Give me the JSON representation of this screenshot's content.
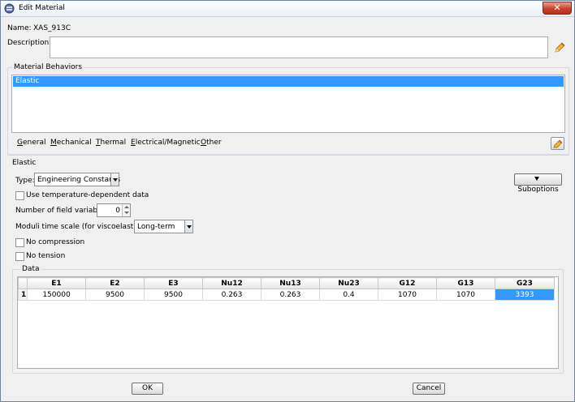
{
  "window": {
    "title": "Edit Material"
  },
  "name_field": {
    "label": "Name:",
    "value": "XAS_913C"
  },
  "description": {
    "label": "Description:",
    "value": ""
  },
  "material_behaviors": {
    "title": "Material Behaviors",
    "items": [
      "Elastic"
    ],
    "selected": "Elastic"
  },
  "menu": {
    "items": [
      {
        "underline": "G",
        "rest": "eneral"
      },
      {
        "underline": "M",
        "rest": "echanical"
      },
      {
        "underline": "T",
        "rest": "hermal"
      },
      {
        "underline": "E",
        "rest": "lectrical/Magnetic"
      },
      {
        "underline": "O",
        "rest": "ther"
      }
    ]
  },
  "elastic": {
    "section_title": "Elastic",
    "type_label": "Type:",
    "type_value": "Engineering Constants",
    "suboptions_label": "Suboptions",
    "temp_dependent_label": "Use temperature-dependent data",
    "temp_dependent_checked": false,
    "field_vars_label": "Number of field variables:",
    "field_vars_value": "0",
    "moduli_label": "Moduli time scale (for viscoelasticity):",
    "moduli_value": "Long-term",
    "no_compression_label": "No compression",
    "no_compression_checked": false,
    "no_tension_label": "No tension",
    "no_tension_checked": false
  },
  "data_table": {
    "title": "Data",
    "columns": [
      "E1",
      "E2",
      "E3",
      "Nu12",
      "Nu13",
      "Nu23",
      "G12",
      "G13",
      "G23"
    ],
    "rows": [
      {
        "index": "1",
        "cells": [
          "150000",
          "9500",
          "9500",
          "0.263",
          "0.263",
          "0.4",
          "1070",
          "1070",
          "3393"
        ]
      }
    ],
    "selected_cell": "G23"
  },
  "buttons": {
    "ok": "OK",
    "cancel": "Cancel"
  },
  "colors": {
    "selection": "#3399ff",
    "close_button": "#c7432d"
  },
  "icons": [
    "edit-material-icon",
    "close-icon",
    "pencil-icon",
    "pencil-eraser-icon"
  ]
}
